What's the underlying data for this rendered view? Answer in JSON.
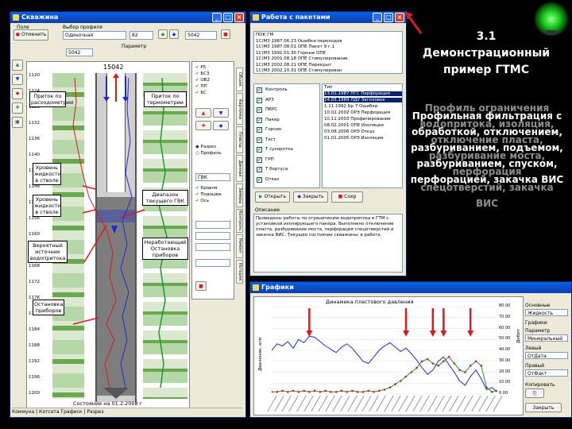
{
  "slide": {
    "title": "3.1 Демонстрационный пример ГТМС",
    "body": "Профильная фильтрация с обработкой, отключением, разбуриванием, подъемом, разбуриванием, спуском, перфорацией, закачка ВИС",
    "body_overlap": "Профиль ограничения водопритока, изоляция, отключение пласта, разбуривание моста, перфорация спецотверстий, закачка ВИС"
  },
  "colors": {
    "accent_green": "#17c617",
    "xp_blue": "#0a5fe6",
    "log_red": "#d81b1b",
    "log_blue": "#1b2bd8",
    "log_green": "#1e9a2a"
  },
  "left_window": {
    "title": "Скважина",
    "toolbar_btn": "Отменить",
    "field_labels": [
      "Поле",
      "Выбор профиля",
      "Параметр"
    ],
    "field_values": [
      "Одиночная",
      "5042",
      "82"
    ],
    "well_label": "15042",
    "depths": [
      "1120",
      "1124",
      "1128",
      "1132",
      "1136",
      "1140",
      "1144",
      "1148",
      "1152",
      "1156",
      "1160",
      "1164",
      "1168",
      "1172",
      "1176",
      "1180",
      "1184",
      "1188",
      "1192",
      "1196",
      "1200"
    ],
    "callouts": {
      "inflow_flow": "Приток по расходометрии",
      "inflow_thermo": "Приток по термометрии",
      "level1": "Уровень жидкости в стволе",
      "level2": "Уровень жидкости в стволе",
      "source": "Вероятный источник водопритока",
      "range": "Диапазон текущего ГВК",
      "unworked": "Неработающий Остановка приборов",
      "stop": "Остановка приборов"
    },
    "footer_status": "Состояние на 01.2.2008 г",
    "statusbar": "Коммуна | Катсата Графиск | Разрез"
  },
  "right_top_window": {
    "title": "Работа с пакетами",
    "history_lines": [
      "ПОК ГМ",
      "1C(M3 1987.06.23 Ошибки переходов",
      "1C(M3 1987.08.01 ОПЕ Пакет 9 г.1",
      "1C(M3 1991.01.30 Горные ОПЕ",
      "1C(M3 2001.08.18 ОПЕ Стимулирование",
      "1C(M3 2002.08.21 ОПЕ Перекрыт",
      "1C(M3 2002.10.31 ОПЕ Стимулирован"
    ],
    "checklist": [
      "Контроль",
      "АРЗ",
      "ПКРС",
      "Пакер",
      "Горсин",
      "Тест",
      "Т сухоротка",
      "ГРП",
      "Т бортуса",
      "Отказ"
    ],
    "right_list": [
      "Тип",
      "13.01.1987 ПГС Перфорация",
      "14.05.1989 ЛДУ Заголовок",
      "1.11.1992 Бр 7 Ошибки",
      "10.02.2002 ОРЭ Перфорация",
      "10.11.2003 Профилирование",
      "08.02.2001 ОПЕ Изоляция",
      "03.08.2006 ОРЭ Отказ",
      "01.01.2005 ОРЭ Изоляция"
    ],
    "btn_open": "Открыть",
    "btn_close": "Закрыть",
    "btn_save": "Сохр",
    "desc_label": "Описание",
    "desc_text": "Проведены работы по ограничению водопритока в ГТМ с установкой изолирующего пакера. Выполнено отключение пласта, разбуривание моста, перфорация спецотверстий и закачка ВИС. Текущее состояние скважины: в работе."
  },
  "right_bottom_window": {
    "title": "Графики",
    "chart_title": "Динамика пластового давления",
    "ylabel_left": "Давление, атм",
    "ylabel_right": "Дебит",
    "right_ticks": [
      "80.00",
      "70.00",
      "60.00",
      "50.00",
      "40.00",
      "30.00",
      "20.00",
      "10.00",
      "0.00"
    ],
    "side_labels": [
      "Основные",
      "Графики",
      "Параметр",
      "Левый",
      "Правый",
      "Копировать",
      "Закрыть"
    ],
    "side_values": [
      "Жидкость",
      "Минеральный",
      "ОтДата",
      "ОтФакт"
    ]
  },
  "chart_data": {
    "type": "line",
    "title": "Динамика пластового давления",
    "ylim_right": [
      0,
      80
    ],
    "series": [
      {
        "values": [
          40,
          46,
          44,
          48,
          42,
          50,
          47,
          53,
          52,
          48,
          44,
          41,
          38,
          43,
          46,
          42,
          36,
          30,
          28,
          34,
          40,
          44,
          47,
          43,
          39,
          42,
          37,
          31,
          24,
          18,
          22,
          30,
          34,
          27,
          20,
          12,
          8,
          16,
          22,
          14,
          4,
          6,
          2
        ]
      },
      {
        "values": [
          2,
          2,
          3,
          2,
          3,
          2,
          3,
          2,
          3,
          2,
          3,
          2,
          2,
          3,
          2,
          3,
          2,
          2,
          3,
          2,
          3,
          4,
          6,
          9,
          12,
          16,
          20,
          24,
          30,
          32,
          28,
          26,
          30,
          34,
          28,
          22,
          20,
          26,
          30,
          26,
          6,
          2,
          3
        ]
      }
    ],
    "markers": [
      7,
      25,
      30,
      32,
      37
    ]
  }
}
